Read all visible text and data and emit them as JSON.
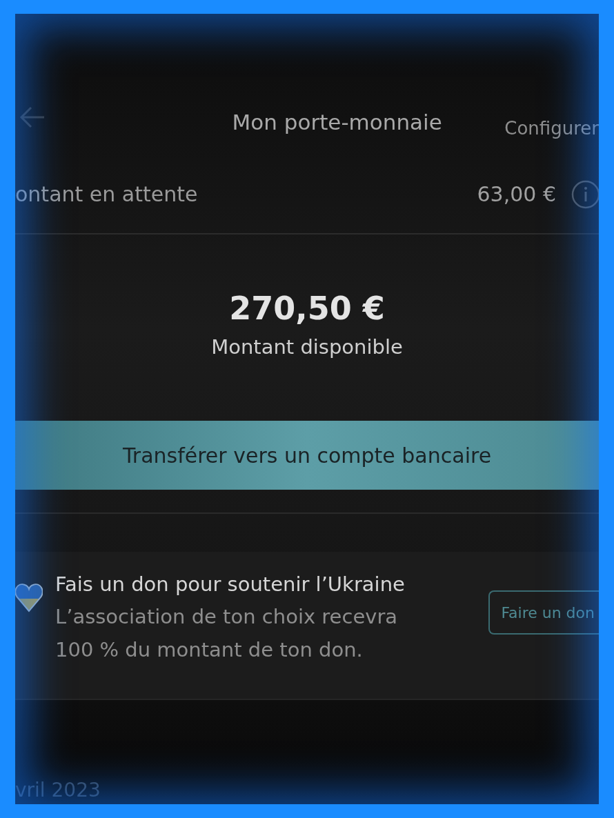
{
  "header": {
    "title": "Mon porte-monnaie",
    "action": "Configurer"
  },
  "pending": {
    "label": "ontant en attente",
    "amount": "63,00 €"
  },
  "balance": {
    "amount": "270,50 €",
    "label": "Montant disponible"
  },
  "transfer_button": "Transférer vers un compte bancaire",
  "donation": {
    "title": "Fais un don pour soutenir l’Ukraine",
    "body": "L’association de ton choix recevra 100 % du montant de ton don.",
    "button": "Faire un don"
  },
  "section_date": "vril 2023"
}
